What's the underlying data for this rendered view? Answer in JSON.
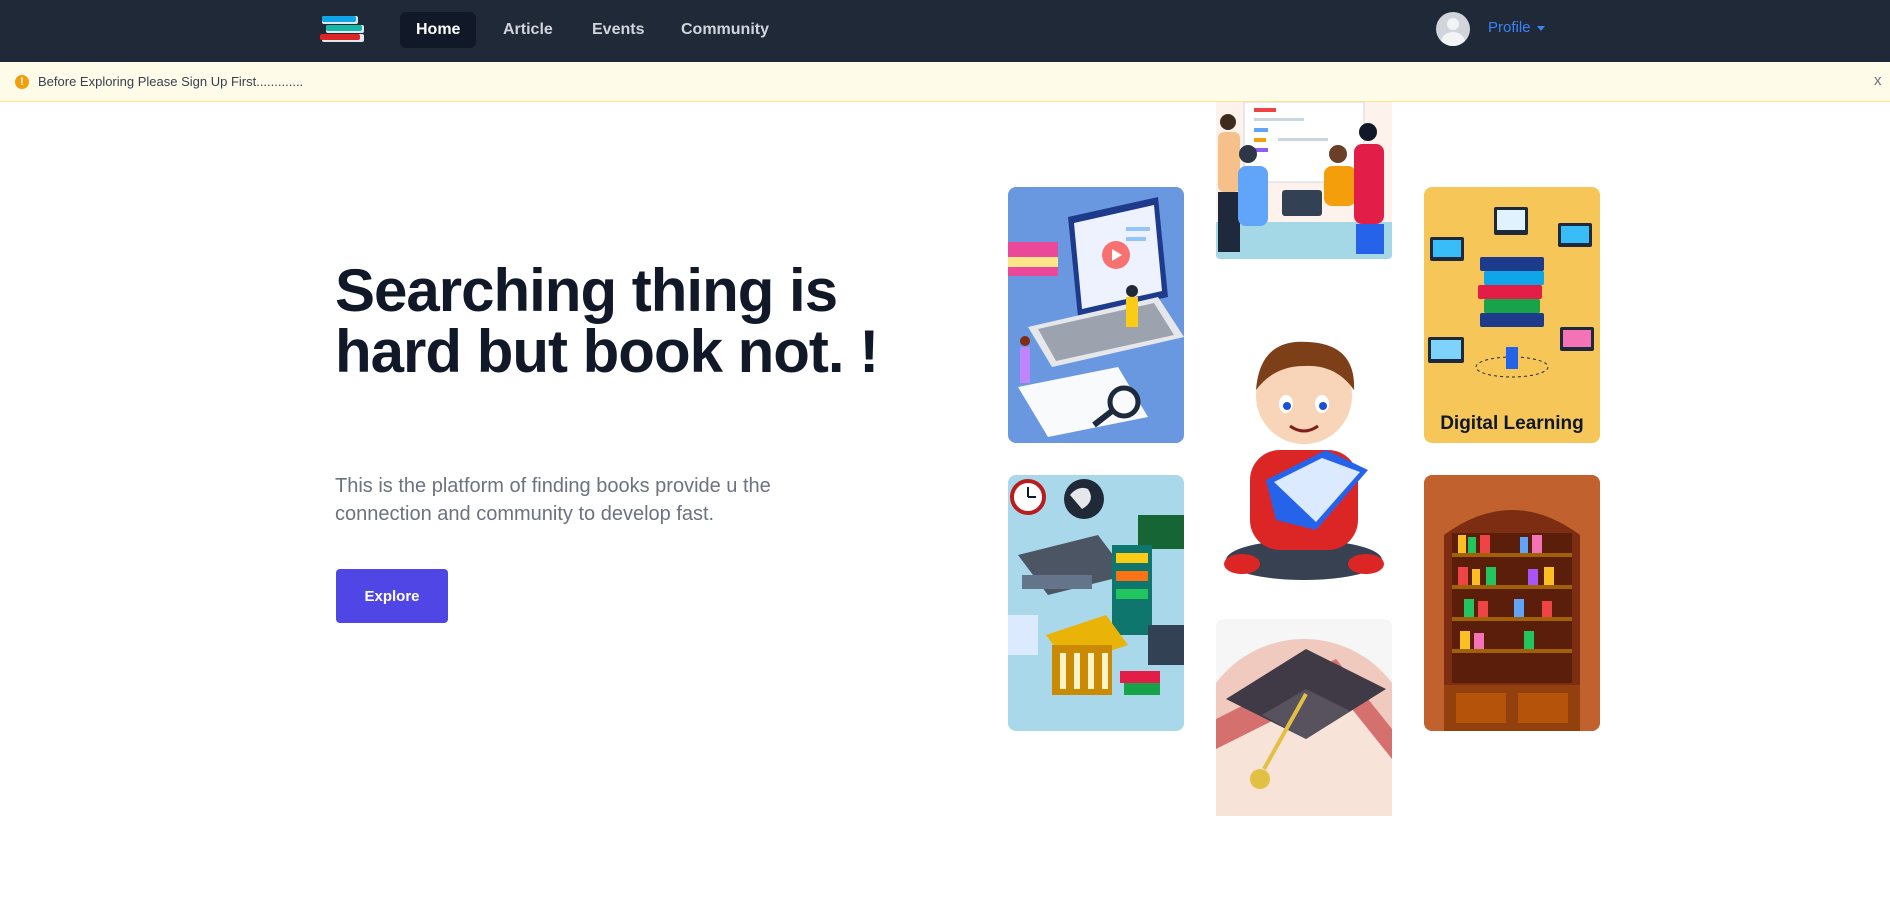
{
  "nav": {
    "links": [
      {
        "label": "Home",
        "active": true
      },
      {
        "label": "Article",
        "active": false
      },
      {
        "label": "Events",
        "active": false
      },
      {
        "label": "Community",
        "active": false
      }
    ],
    "profile_label": "Profile"
  },
  "alert": {
    "message": "Before Exploring Please Sign Up First.............",
    "close_label": "x",
    "icon": "!"
  },
  "hero": {
    "title": "Searching thing is hard but book not. !",
    "subtitle": "This is the platform of finding books provide u the connection and community to develop fast.",
    "button_label": "Explore"
  },
  "gallery": {
    "digital_learning_label": "Digital Learning"
  },
  "colors": {
    "nav_bg": "#1f2937",
    "accent": "#4f46e5",
    "link": "#3b82f6",
    "alert_bg": "#fefce8",
    "alert_icon": "#f59e0b"
  }
}
